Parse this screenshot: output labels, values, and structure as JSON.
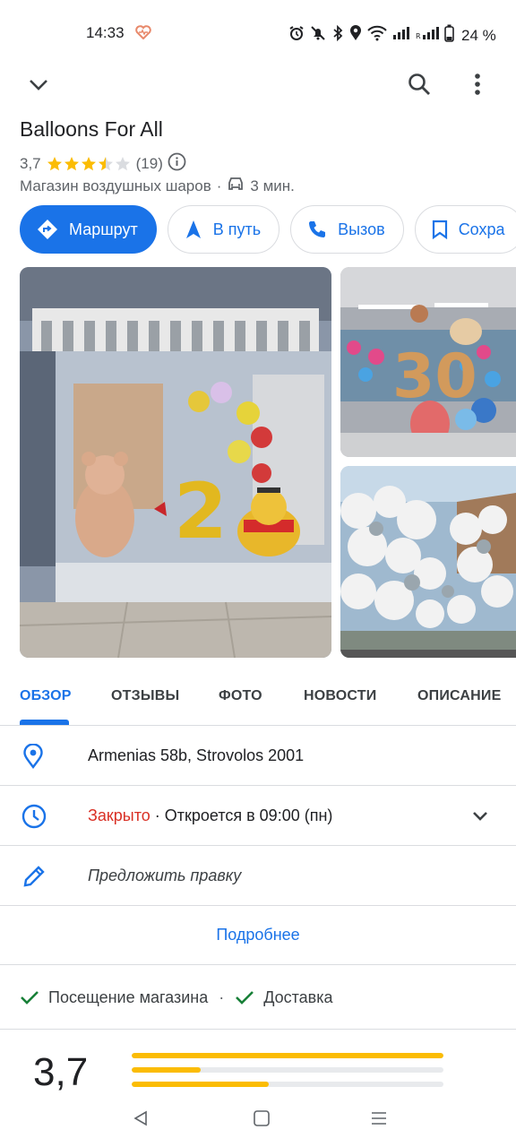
{
  "status_bar": {
    "time": "14:33",
    "battery": "24 %"
  },
  "place": {
    "name": "Balloons For All",
    "rating": "3,7",
    "stars": 3.5,
    "reviews": "(19)",
    "category": "Магазин воздушных шаров",
    "separator": "·",
    "drive_time": "3 мин."
  },
  "actions": [
    {
      "label": "Маршрут",
      "icon": "directions-icon"
    },
    {
      "label": "В путь",
      "icon": "navigation-icon"
    },
    {
      "label": "Вызов",
      "icon": "phone-icon"
    },
    {
      "label": "Сохра",
      "icon": "bookmark-icon"
    }
  ],
  "tabs": [
    "ОБЗОР",
    "ОТЗЫВЫ",
    "ФОТО",
    "НОВОСТИ",
    "ОПИСАНИЕ"
  ],
  "info": {
    "address": "Armenias 58b, Strovolos 2001",
    "hours_status": "Закрыто",
    "hours_detail": " · Откроется в 09:00 (пн)",
    "suggest_edit": "Предложить правку",
    "more": "Подробнее"
  },
  "features": {
    "in_store": "Посещение магазина",
    "separator": "·",
    "delivery": "Доставка"
  },
  "rating_summary": {
    "value": "3,7",
    "bars": [
      1.0,
      0.22,
      0.44
    ]
  },
  "colors": {
    "accent": "#1a73e8",
    "star": "#fbbc04",
    "closed": "#d93025",
    "check": "#188038"
  }
}
